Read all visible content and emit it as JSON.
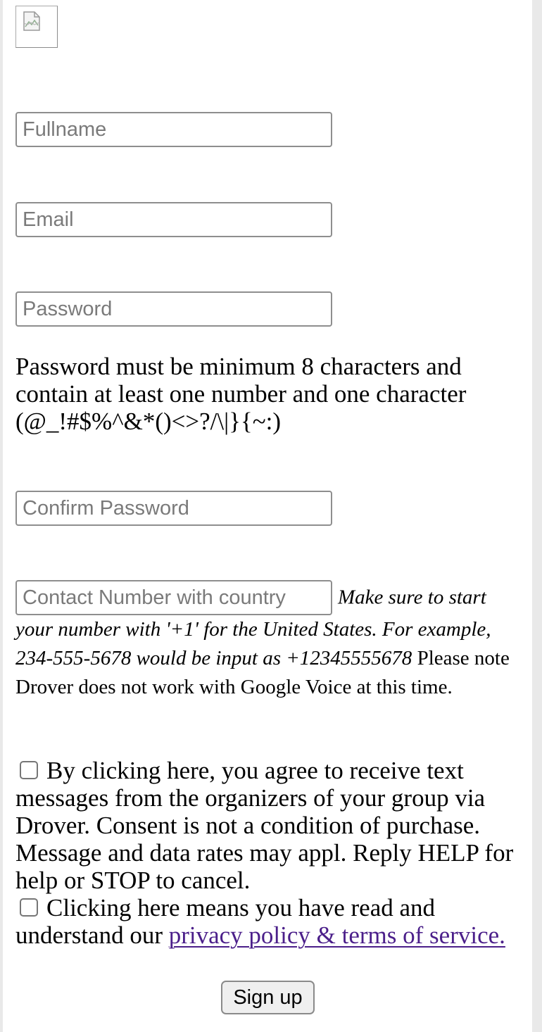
{
  "form": {
    "fullname_placeholder": "Fullname",
    "email_placeholder": "Email",
    "password_placeholder": "Password",
    "password_rules": "Password must be minimum 8 characters and contain at least one number and one character (@_!#$%^&*()<>?/\\|}{~:)",
    "confirm_password_placeholder": "Confirm Password",
    "phone_placeholder": "Contact Number with country",
    "phone_help_italic": "Make sure to start your number with '+1' for the United States. For example, 234-555-5678 would be input as +12345555678",
    "phone_help_note": " Please note Drover does not work with Google Voice at this time.",
    "sms_consent_text": "By clicking here, you agree to receive text messages from the organizers of your group via Drover. Consent is not a condition of purchase. Message and data rates may appl. Reply HELP for help or STOP to cancel.",
    "terms_text": "Clicking here means you have read and understand our ",
    "terms_link": "privacy policy & terms of service.",
    "signup_label": "Sign up"
  },
  "icons": {
    "logo": "broken-image-icon",
    "checkbox": "checkbox-icon"
  },
  "colors": {
    "link": "#4b1f8a",
    "field_border": "#8e8e8e",
    "placeholder": "#7a7a7a",
    "button_bg": "#efefef"
  }
}
